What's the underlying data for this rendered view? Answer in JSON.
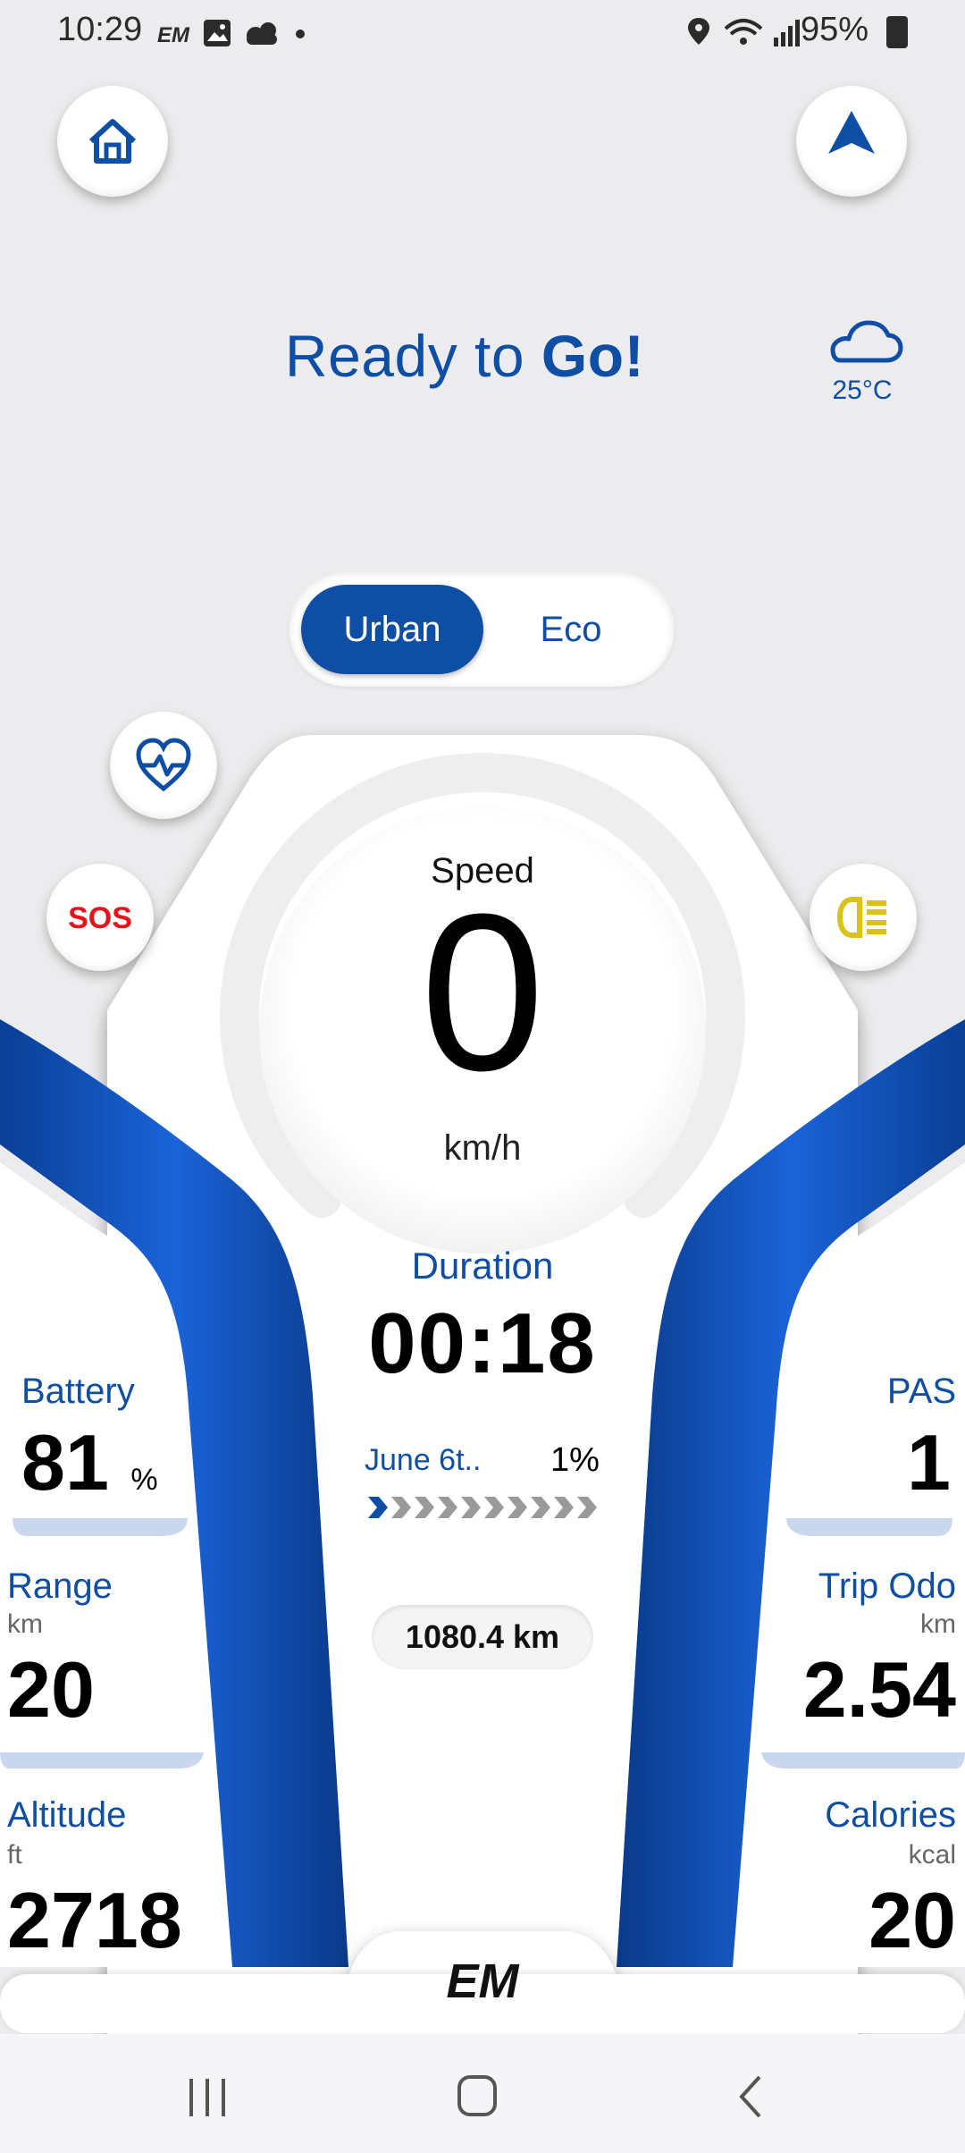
{
  "status_bar": {
    "time": "10:29",
    "battery": "95%",
    "icons": [
      "em-app-icon",
      "gallery-icon",
      "weather-icon",
      "dot-icon",
      "location-icon",
      "wifi-icon",
      "signal-icon",
      "battery-icon"
    ]
  },
  "header": {
    "home_icon": "home-icon",
    "navigate_icon": "navigation-arrow-icon",
    "greeting_prefix": "Ready to ",
    "greeting_bold": "Go!",
    "weather_icon": "cloud-icon",
    "temperature": "25°C"
  },
  "modes": {
    "active": "Urban",
    "other": "Eco"
  },
  "side_buttons": {
    "heart": "heart-rate-icon",
    "sos": "SOS",
    "headlight": "headlight-icon"
  },
  "speedometer": {
    "label": "Speed",
    "value": "0",
    "unit": "km/h"
  },
  "duration": {
    "label": "Duration",
    "value": "00:18"
  },
  "trip": {
    "name": "June 6t..",
    "percent": "1%",
    "progress": 0.01
  },
  "odometer": "1080.4 km",
  "stats_left": {
    "battery": {
      "label": "Battery",
      "value": "81",
      "unit": "%"
    },
    "range": {
      "label": "Range",
      "unit": "km",
      "value": "20"
    },
    "altitude": {
      "label": "Altitude",
      "unit": "ft",
      "value": "2718"
    }
  },
  "stats_right": {
    "pas": {
      "label": "PAS",
      "value": "1"
    },
    "trip_odo": {
      "label": "Trip Odo",
      "unit": "km",
      "value": "2.54"
    },
    "calories": {
      "label": "Calories",
      "unit": "kcal",
      "value": "20"
    }
  },
  "logo": "EM",
  "colors": {
    "primary": "#0e4ea4",
    "background": "#ececee",
    "sos_red": "#e5141c",
    "headlight_yellow": "#d9c21a"
  }
}
